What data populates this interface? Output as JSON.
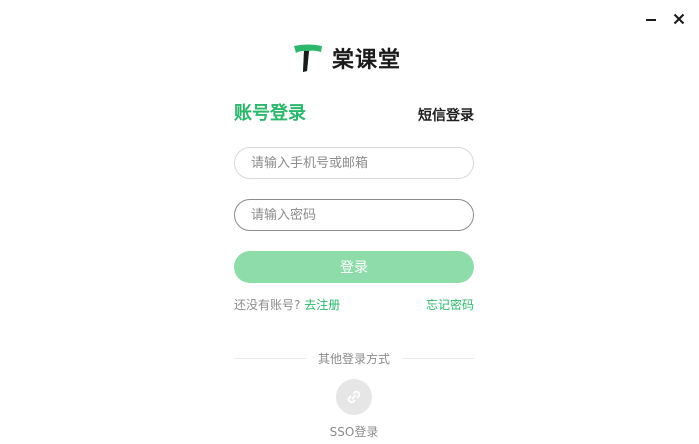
{
  "window": {
    "minimize_icon": "minimize-icon",
    "close_icon": "close-icon"
  },
  "brand": {
    "name": "棠课堂",
    "logo_icon": "brand-logo-icon",
    "color": "#2db76c"
  },
  "tabs": {
    "account_login": "账号登录",
    "sms_login": "短信登录",
    "active": "account_login"
  },
  "form": {
    "account_placeholder": "请输入手机号或邮箱",
    "account_value": "",
    "password_placeholder": "请输入密码",
    "password_value": "",
    "login_label": "登录"
  },
  "links": {
    "no_account": "还没有账号?",
    "register": "去注册",
    "forgot_password": "忘记密码"
  },
  "other_login": {
    "divider_text": "其他登录方式",
    "sso_icon": "link-icon",
    "sso_label": "SSO登录"
  },
  "colors": {
    "accent": "#2db76c",
    "button_disabled": "#8fdcab",
    "muted_text": "#8c8c8c"
  }
}
